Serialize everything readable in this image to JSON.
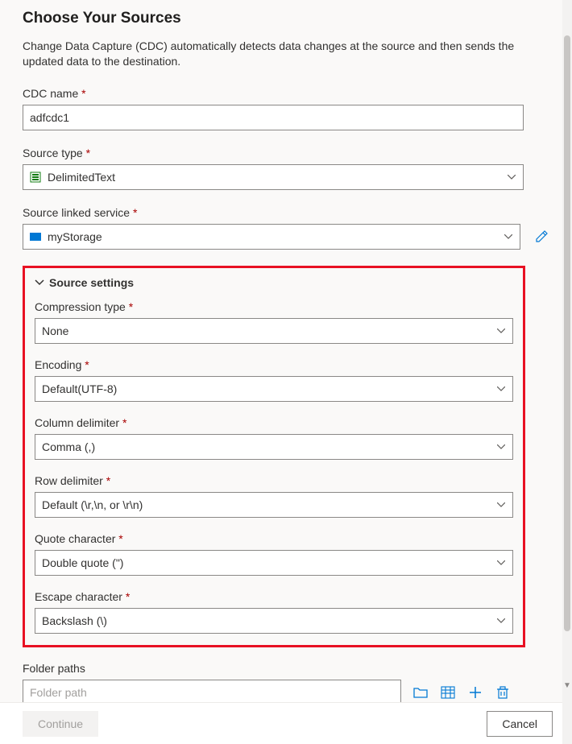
{
  "header": {
    "title": "Choose Your Sources",
    "description": "Change Data Capture (CDC) automatically detects data changes at the source and then sends the updated data to the destination."
  },
  "fields": {
    "cdc_name": {
      "label": "CDC name",
      "value": "adfcdc1"
    },
    "source_type": {
      "label": "Source type",
      "value": "DelimitedText"
    },
    "source_linked_service": {
      "label": "Source linked service",
      "value": "myStorage"
    }
  },
  "source_settings": {
    "heading": "Source settings",
    "compression_type": {
      "label": "Compression type",
      "value": "None"
    },
    "encoding": {
      "label": "Encoding",
      "value": "Default(UTF-8)"
    },
    "column_delimiter": {
      "label": "Column delimiter",
      "value": "Comma (,)"
    },
    "row_delimiter": {
      "label": "Row delimiter",
      "value": "Default (\\r,\\n, or \\r\\n)"
    },
    "quote_character": {
      "label": "Quote character",
      "value": "Double quote (\")"
    },
    "escape_character": {
      "label": "Escape character",
      "value": "Backslash (\\)"
    }
  },
  "folder_paths": {
    "label": "Folder paths",
    "placeholder": "Folder path"
  },
  "footer": {
    "continue_label": "Continue",
    "cancel_label": "Cancel"
  },
  "icons": {
    "chevron_down": "chevron-down-icon",
    "edit": "edit-icon",
    "browse": "browse-folder-icon",
    "preview": "preview-data-icon",
    "add": "add-icon",
    "delete": "delete-icon"
  }
}
